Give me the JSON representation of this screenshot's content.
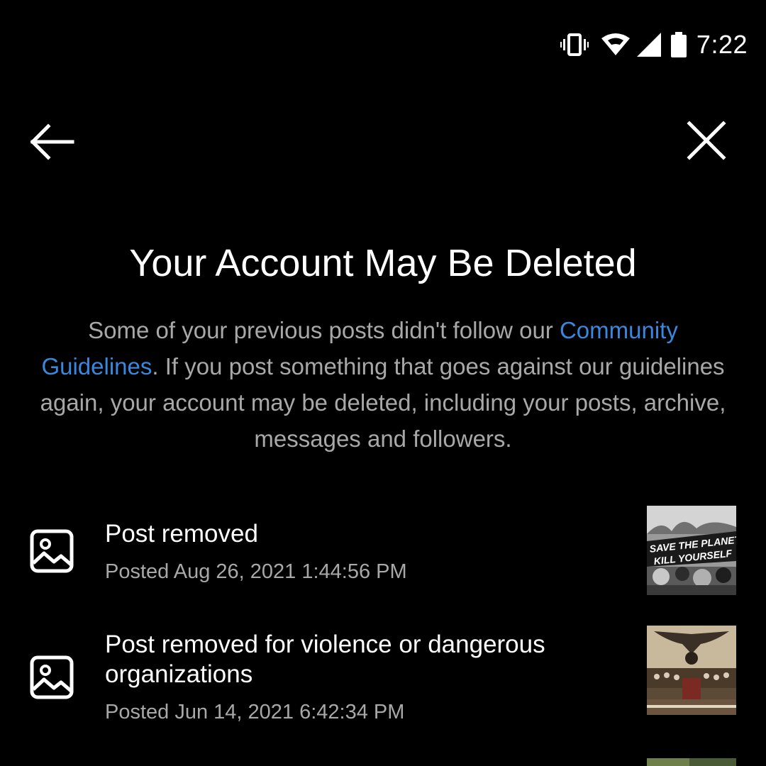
{
  "status_bar": {
    "icons": [
      "vibrate-icon",
      "wifi-icon",
      "cellular-signal-icon",
      "battery-icon"
    ],
    "time": "7:22"
  },
  "nav": {
    "back_icon": "back-arrow-icon",
    "close_icon": "close-icon"
  },
  "page": {
    "title": "Your Account May Be Deleted",
    "description_before": "Some of your previous posts didn't follow our ",
    "description_link": "Community Guidelines",
    "description_after": ". If you post something that goes against our guidelines again, your account may be deleted, including your posts, archive, messages and followers."
  },
  "colors": {
    "background": "#000000",
    "text_primary": "#ffffff",
    "text_secondary": "#a8a8a8",
    "link": "#3a87de"
  },
  "removed_posts": [
    {
      "icon": "image-icon",
      "title": "Post removed",
      "posted": "Posted Aug 26, 2021 1:44:56 PM",
      "thumbnail_text": [
        "SAVE THE PLANET",
        "KILL YOURSELF"
      ]
    },
    {
      "icon": "image-icon",
      "title": "Post removed for violence or dangerous organizations",
      "posted": "Posted Jun 14, 2021 6:42:34 PM",
      "thumbnail_text": []
    }
  ]
}
